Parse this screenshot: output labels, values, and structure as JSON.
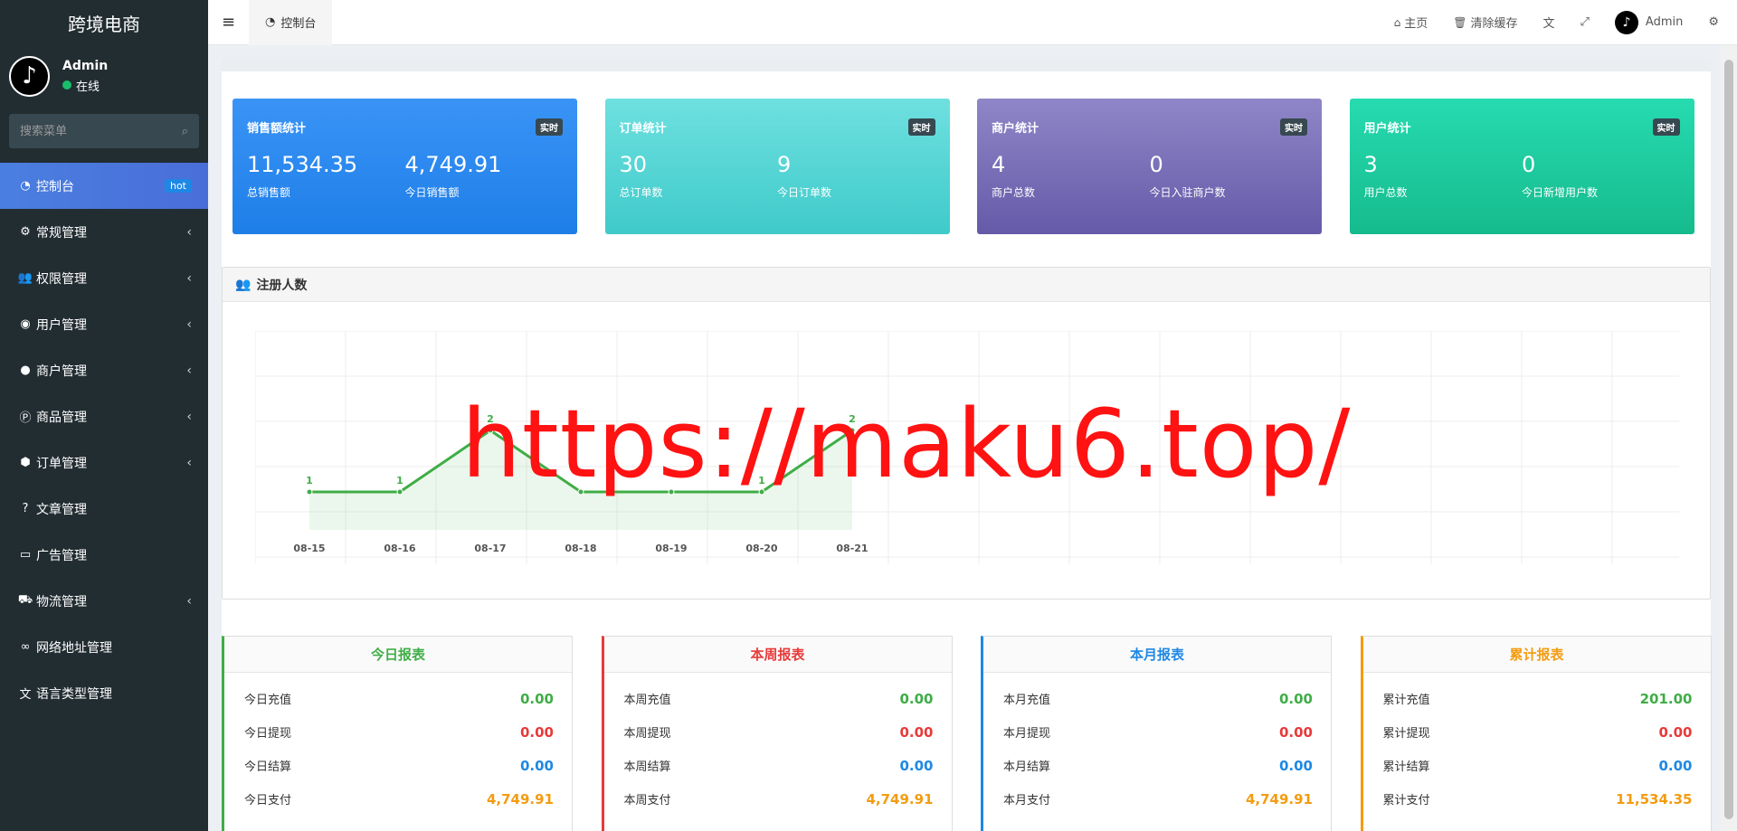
{
  "brand": "跨境电商",
  "user": {
    "name": "Admin",
    "status": "在线",
    "avatar_glyph": "♪"
  },
  "search": {
    "placeholder": "搜索菜单"
  },
  "menu": [
    {
      "label": "控制台",
      "icon": "dashboard-icon",
      "glyph": "◔",
      "badge": "hot",
      "active": true
    },
    {
      "label": "常规管理",
      "icon": "cogs-icon",
      "glyph": "⚙",
      "chevron": "‹"
    },
    {
      "label": "权限管理",
      "icon": "users-icon",
      "glyph": "👥",
      "chevron": "‹"
    },
    {
      "label": "用户管理",
      "icon": "user-circle-icon",
      "glyph": "◉",
      "chevron": "‹"
    },
    {
      "label": "商户管理",
      "icon": "apple-icon",
      "glyph": "●",
      "chevron": "‹"
    },
    {
      "label": "商品管理",
      "icon": "product-icon",
      "glyph": "Ⓟ",
      "chevron": "‹"
    },
    {
      "label": "订单管理",
      "icon": "cube-icon",
      "glyph": "⬢",
      "chevron": "‹"
    },
    {
      "label": "文章管理",
      "icon": "question-icon",
      "glyph": "?"
    },
    {
      "label": "广告管理",
      "icon": "ad-card-icon",
      "glyph": "▭"
    },
    {
      "label": "物流管理",
      "icon": "truck-icon",
      "glyph": "⛟",
      "chevron": "‹"
    },
    {
      "label": "网络地址管理",
      "icon": "link-icon",
      "glyph": "∞"
    },
    {
      "label": "语言类型管理",
      "icon": "language-icon",
      "glyph": "文"
    }
  ],
  "topbar": {
    "tab": "控制台",
    "home": "主页",
    "clear_cache": "清除缓存",
    "admin": "Admin"
  },
  "stats": [
    {
      "title": "销售额统计",
      "badge": "实时",
      "v1": "11,534.35",
      "l1": "总销售额",
      "v2": "4,749.91",
      "l2": "今日销售额",
      "color": "#2f8af2"
    },
    {
      "title": "订单统计",
      "badge": "实时",
      "v1": "30",
      "l1": "总订单数",
      "v2": "9",
      "l2": "今日订单数",
      "color": "#52d2d2"
    },
    {
      "title": "商户统计",
      "badge": "实时",
      "v1": "4",
      "l1": "商户总数",
      "v2": "0",
      "l2": "今日入驻商户数",
      "color": "#7a6fb8"
    },
    {
      "title": "用户统计",
      "badge": "实时",
      "v1": "3",
      "l1": "用户总数",
      "v2": "0",
      "l2": "今日新增用户数",
      "color": "#1fcf9f"
    }
  ],
  "chart_panel": {
    "title": "注册人数"
  },
  "chart_data": {
    "type": "line",
    "categories": [
      "08-15",
      "08-16",
      "08-17",
      "08-18",
      "08-19",
      "08-20",
      "08-21"
    ],
    "series": [
      {
        "values": [
          1,
          1,
          2,
          1,
          1,
          1,
          2
        ]
      }
    ],
    "visible_labels": [
      "1",
      "1",
      "2",
      "",
      "",
      "1",
      "2"
    ],
    "grid": true,
    "color": "#3fad46"
  },
  "reports": [
    {
      "title": "今日报表",
      "color": "#3fad46",
      "rows": [
        {
          "label": "今日充值",
          "value": "0.00",
          "vcolor": "#3fad46"
        },
        {
          "label": "今日提现",
          "value": "0.00",
          "vcolor": "#e83a3a"
        },
        {
          "label": "今日结算",
          "value": "0.00",
          "vcolor": "#1e88e5"
        },
        {
          "label": "今日支付",
          "value": "4,749.91",
          "vcolor": "#f39c12"
        }
      ]
    },
    {
      "title": "本周报表",
      "color": "#e83a3a",
      "rows": [
        {
          "label": "本周充值",
          "value": "0.00",
          "vcolor": "#3fad46"
        },
        {
          "label": "本周提现",
          "value": "0.00",
          "vcolor": "#e83a3a"
        },
        {
          "label": "本周结算",
          "value": "0.00",
          "vcolor": "#1e88e5"
        },
        {
          "label": "本周支付",
          "value": "4,749.91",
          "vcolor": "#f39c12"
        }
      ]
    },
    {
      "title": "本月报表",
      "color": "#1e88e5",
      "rows": [
        {
          "label": "本月充值",
          "value": "0.00",
          "vcolor": "#3fad46"
        },
        {
          "label": "本月提现",
          "value": "0.00",
          "vcolor": "#e83a3a"
        },
        {
          "label": "本月结算",
          "value": "0.00",
          "vcolor": "#1e88e5"
        },
        {
          "label": "本月支付",
          "value": "4,749.91",
          "vcolor": "#f39c12"
        }
      ]
    },
    {
      "title": "累计报表",
      "color": "#f39c12",
      "rows": [
        {
          "label": "累计充值",
          "value": "201.00",
          "vcolor": "#3fad46"
        },
        {
          "label": "累计提现",
          "value": "0.00",
          "vcolor": "#e83a3a"
        },
        {
          "label": "累计结算",
          "value": "0.00",
          "vcolor": "#1e88e5"
        },
        {
          "label": "累计支付",
          "value": "11,534.35",
          "vcolor": "#f39c12"
        }
      ]
    }
  ],
  "watermark": "https://maku6.top/"
}
